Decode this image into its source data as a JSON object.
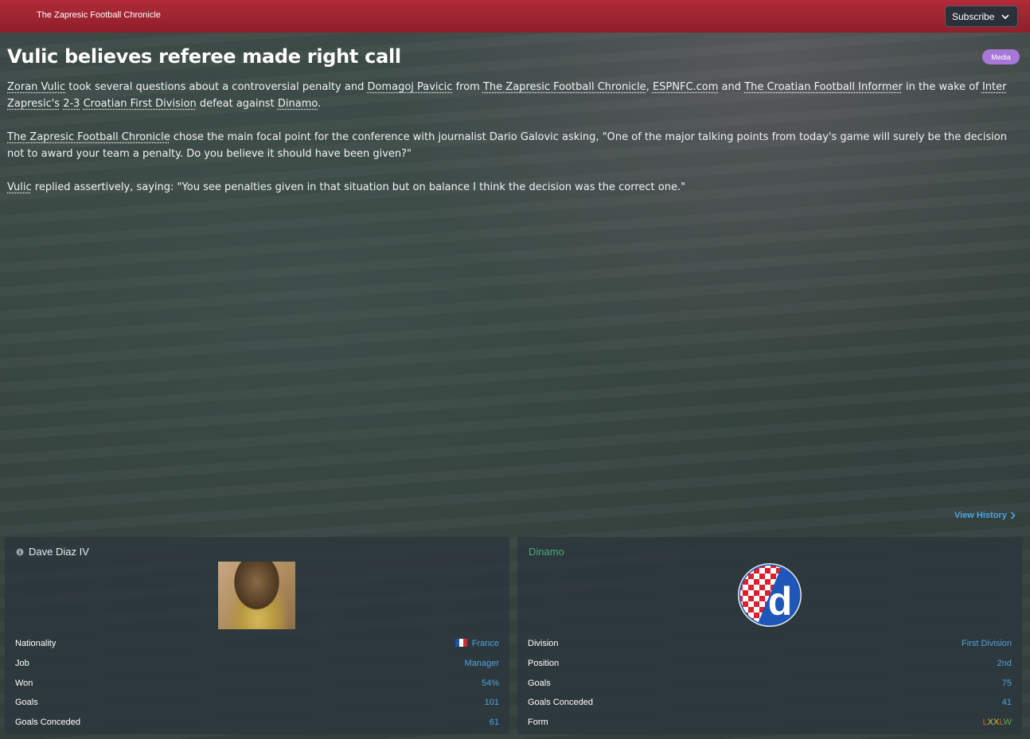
{
  "header": {
    "publication": "The Zapresic Football Chronicle",
    "subscribe_label": "Subscribe"
  },
  "article": {
    "headline": "Vulic believes referee made right call",
    "badge": "Media",
    "p1": {
      "manager": "Zoran Vulic",
      "t1": " took several questions about a controversial penalty and ",
      "player": "Domagoj Pavicic",
      "t2": " from ",
      "outlet1": "The Zapresic Football Chronicle",
      "t3": ", ",
      "outlet2": "ESPNFC.com",
      "t4": " and ",
      "outlet3": "The Croatian Football Informer",
      "t5": " in the wake of ",
      "club": "Inter Zapresic's",
      "t6": " ",
      "score": "2-3",
      "t7": " ",
      "competition": "Croatian First Division",
      "t8": " defeat against ",
      "opponent": "Dinamo",
      "t9": "."
    },
    "p2": {
      "outlet": "The Zapresic Football Chronicle",
      "text": " chose the main focal point for the conference with journalist Dario Galovic asking, \"One of the major talking points from today's game will surely be the decision not to award your team a penalty. Do you believe it should have been given?\""
    },
    "p3": {
      "name": "Vulic",
      "text": " replied assertively, saying: \"You see penalties given in that situation but on balance I think the decision was the correct one.\""
    },
    "view_history": "View History"
  },
  "manager_panel": {
    "name": "Dave Diaz IV",
    "rows": [
      {
        "label": "Nationality",
        "value": "France"
      },
      {
        "label": "Job",
        "value": "Manager"
      },
      {
        "label": "Won",
        "value": "54%"
      },
      {
        "label": "Goals",
        "value": "101"
      },
      {
        "label": "Goals Conceded",
        "value": "61"
      }
    ],
    "flag_colors": [
      "#1f4fb0",
      "#ffffff",
      "#d42b3a"
    ]
  },
  "club_panel": {
    "name": "Dinamo",
    "rows": [
      {
        "label": "Division",
        "value": "First Division"
      },
      {
        "label": "Position",
        "value": "2nd"
      },
      {
        "label": "Goals",
        "value": "75"
      },
      {
        "label": "Goals Conceded",
        "value": "41"
      },
      {
        "label": "Form",
        "value": "LXXLW"
      }
    ],
    "form": [
      "L",
      "X",
      "X",
      "L",
      "W"
    ],
    "crest_colors": {
      "blue": "#1f57b8",
      "red": "#d8202e",
      "white": "#ffffff"
    }
  },
  "colors": {
    "header_red": "#a8283a",
    "link_blue": "#4fa3e0",
    "badge_purple": "#a878d8",
    "club_green": "#48a87a"
  }
}
